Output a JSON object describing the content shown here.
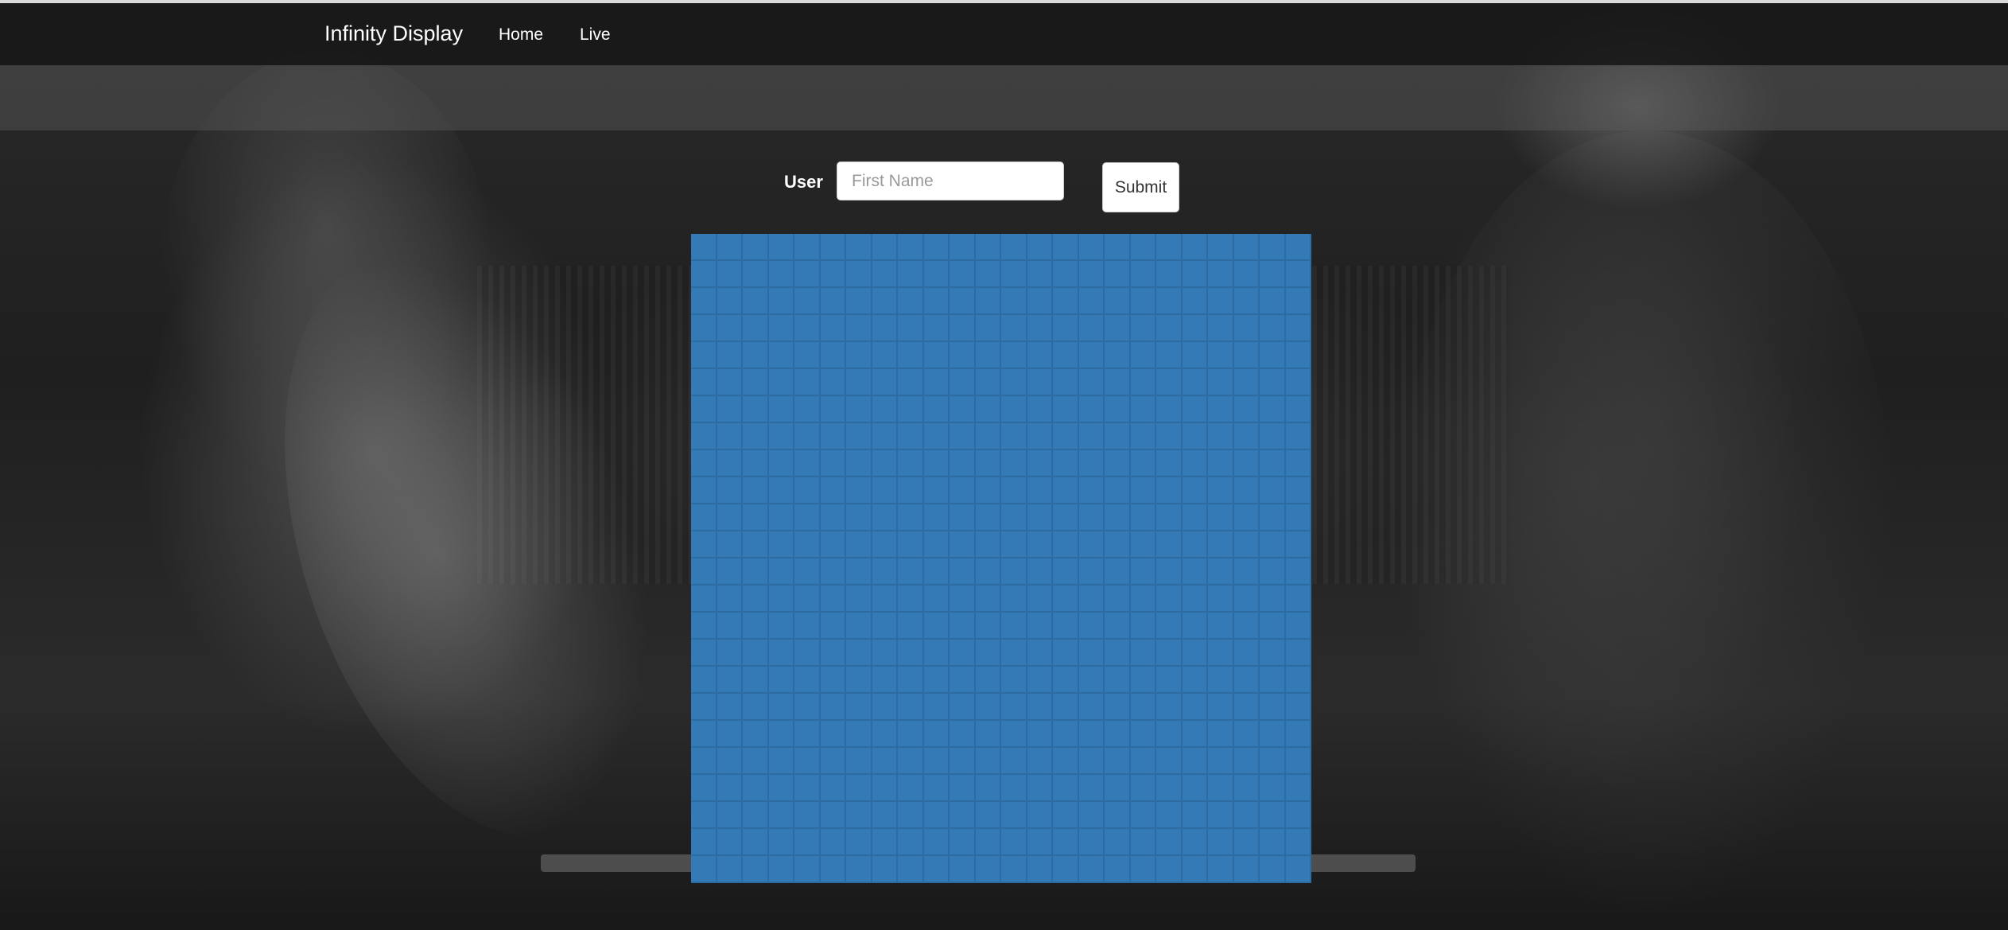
{
  "navbar": {
    "brand": "Infinity Display",
    "links": [
      {
        "label": "Home"
      },
      {
        "label": "Live"
      }
    ]
  },
  "form": {
    "user_label": "User",
    "first_name_placeholder": "First Name",
    "first_name_value": "",
    "submit_label": "Submit"
  },
  "display_grid": {
    "rows": 24,
    "columns": 24,
    "cell_color": "#337ab7",
    "cell_border_color": "#2c6ca3"
  },
  "colors": {
    "navbar_bg": "#161616",
    "text": "#ffffff",
    "accent_blue": "#337ab7"
  }
}
